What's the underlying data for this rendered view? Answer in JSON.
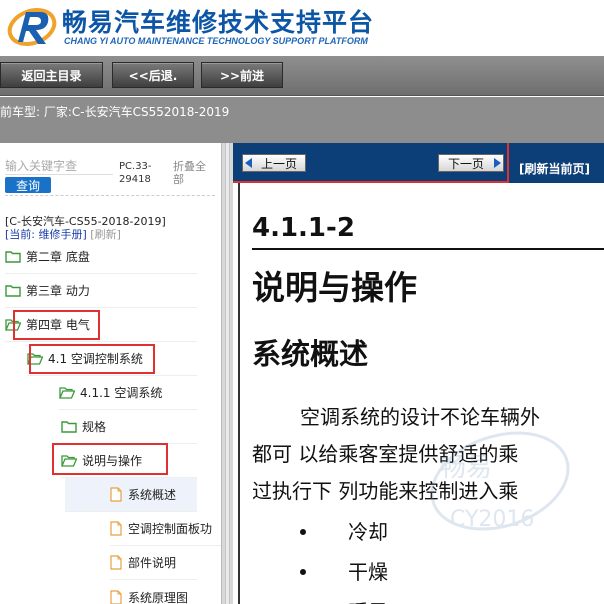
{
  "header": {
    "title": "畅易汽车维修技术支持平台",
    "subtitle": "CHANG YI AUTO MAINTENANCE TECHNOLOGY SUPPORT PLATFORM"
  },
  "toolbar": {
    "home_label": "返回主目录",
    "back_label": "<<后退.",
    "forward_label": ">>前进"
  },
  "vehicle_bar": {
    "text": "前车型:  厂家:C-长安汽车CS552018-2019"
  },
  "sidebar": {
    "search_placeholder": "输入关键字查",
    "query_label": "查询",
    "code": "PC.33-29418",
    "fold_all": "折叠全部",
    "model": "[C-长安汽车-CS55-2018-2019]",
    "current": "[当前: 维修手册]",
    "refresh": "[刷新]",
    "tree": [
      {
        "label": "第二章 底盘",
        "type": "folder"
      },
      {
        "label": "第三章 动力",
        "type": "folder"
      },
      {
        "label": "第四章 电气",
        "type": "folder-open"
      },
      {
        "label": "4.1 空调控制系统",
        "type": "folder-open"
      },
      {
        "label": "4.1.1 空调系统",
        "type": "folder-open"
      },
      {
        "label": "规格",
        "type": "folder"
      },
      {
        "label": "说明与操作",
        "type": "folder-open"
      },
      {
        "label": "系统概述",
        "type": "doc"
      },
      {
        "label": "空调控制面板功",
        "type": "doc"
      },
      {
        "label": "部件说明",
        "type": "doc"
      },
      {
        "label": "系统原理图",
        "type": "doc"
      }
    ]
  },
  "nav": {
    "prev_label": "上一页",
    "next_label": "下一页",
    "refresh_label": "[刷新当前页]"
  },
  "document": {
    "section_number": "4.1.1-2",
    "heading1": "说明与操作",
    "heading2": "系统概述",
    "paragraph_lines": [
      "空调系统的设计不论车辆外",
      "都可  以给乘客室提供舒适的乘",
      "过执行下  列功能来控制进入乘"
    ],
    "bullets": [
      "冷却",
      "干燥",
      "暖风"
    ]
  },
  "watermark": {
    "line1": "畅易",
    "line2": "CY2016"
  },
  "colors": {
    "brand_blue": "#0d56a6",
    "nav_bar": "#0c3f78",
    "annotation_red": "#e03030",
    "query_button": "#1a72c8"
  }
}
